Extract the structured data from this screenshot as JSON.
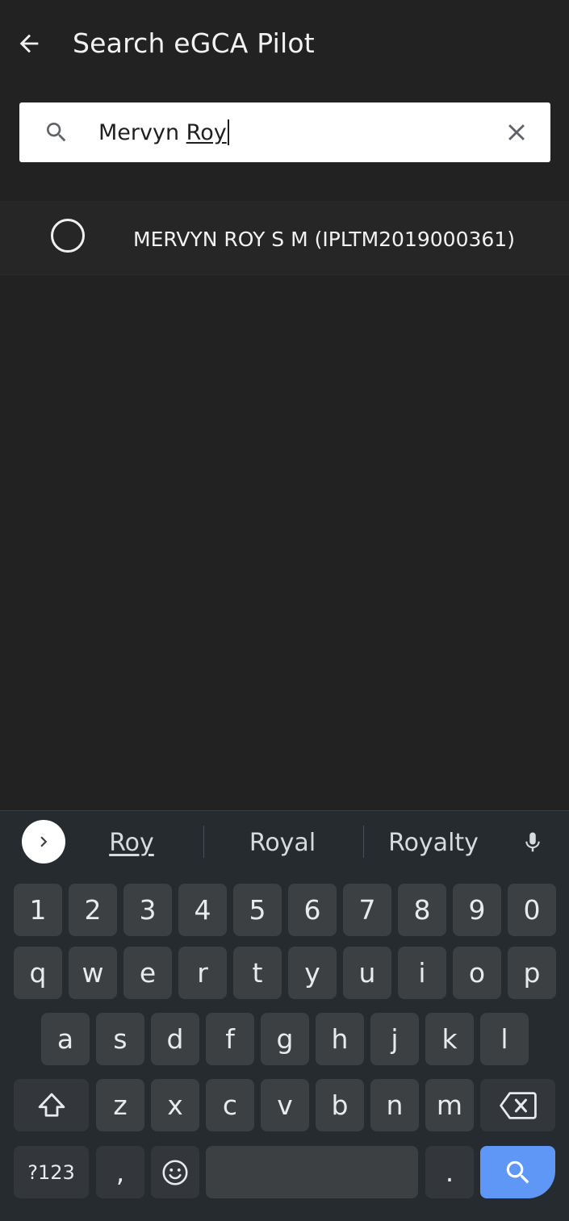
{
  "app_bar": {
    "title": "Search eGCA Pilot",
    "back_icon": "arrow-left-icon"
  },
  "search": {
    "value_plain": "Mervyn ",
    "value_underlined": "Roy",
    "search_icon": "search-icon",
    "clear_icon": "close-icon"
  },
  "results": [
    {
      "label": "MERVYN ROY S M (IPLTM2019000361)",
      "selected": false
    }
  ],
  "keyboard": {
    "suggestions": [
      "Roy",
      "Royal",
      "Royalty"
    ],
    "row_numbers": [
      "1",
      "2",
      "3",
      "4",
      "5",
      "6",
      "7",
      "8",
      "9",
      "0"
    ],
    "row_q": [
      "q",
      "w",
      "e",
      "r",
      "t",
      "y",
      "u",
      "i",
      "o",
      "p"
    ],
    "row_a": [
      "a",
      "s",
      "d",
      "f",
      "g",
      "h",
      "j",
      "k",
      "l"
    ],
    "row_z": [
      "z",
      "x",
      "c",
      "v",
      "b",
      "n",
      "m"
    ],
    "symbols_label": "?123",
    "comma_label": ",",
    "period_label": ".",
    "colors": {
      "background": "#262b30",
      "key": "#3c4043",
      "action_key": "#5e97f6"
    }
  }
}
